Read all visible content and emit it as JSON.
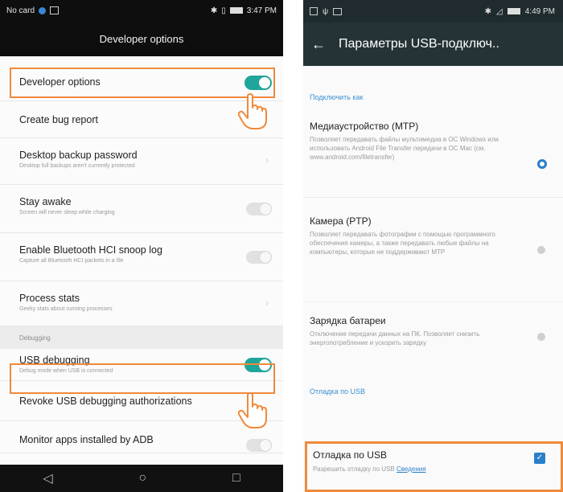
{
  "left": {
    "status": {
      "carrier": "No card",
      "time": "3:47 PM"
    },
    "title": "Developer options",
    "items": [
      {
        "title": "Developer options"
      },
      {
        "title": "Create bug report"
      },
      {
        "title": "Desktop backup password",
        "subtitle": "Desktop full backups aren't currently protected"
      },
      {
        "title": "Stay awake",
        "subtitle": "Screen will never sleep while charging"
      },
      {
        "title": "Enable Bluetooth HCI snoop log",
        "subtitle": "Capture all Bluetooth HCI packets in a file"
      },
      {
        "title": "Process stats",
        "subtitle": "Geeky stats about running processes"
      },
      {
        "title": "USB debugging",
        "subtitle": "Debug mode when USB is connected"
      },
      {
        "title": "Revoke USB debugging authorizations"
      },
      {
        "title": "Monitor apps installed by ADB"
      }
    ],
    "section_debugging": "Debugging",
    "nav": {
      "back": "◁",
      "home": "○",
      "recents": "□"
    }
  },
  "right": {
    "status": {
      "time": "4:49 PM"
    },
    "title": "Параметры USB-подключ..",
    "group_connect": "Подключить как",
    "options": [
      {
        "title": "Медиаустройство (MTP)",
        "desc": "Позволяет передавать файлы мультимедиа в ОС Windows или использовать Android File Transfer передачи в ОС Mac (см. www.android.com/filetransfer)"
      },
      {
        "title": "Камера (PTP)",
        "desc": "Позволяет передавать фотографии с помощью программного обеспечения камеры, а также передавать любые файлы на компьютеры, которые не поддерживают MTP"
      },
      {
        "title": "Зарядка батареи",
        "desc": "Отключение передачи данных на ПК. Позволяет снизить энергопотребление и ускорить зарядку"
      }
    ],
    "group_debug": "Отладка по USB",
    "usb_debug": {
      "title": "Отладка по USB",
      "desc": "Разрешить отладку по USB",
      "link": "Сведения"
    }
  },
  "colors": {
    "accent_teal": "#1fa59a",
    "highlight_orange": "#f08a3b",
    "blue": "#2a7fc9"
  }
}
